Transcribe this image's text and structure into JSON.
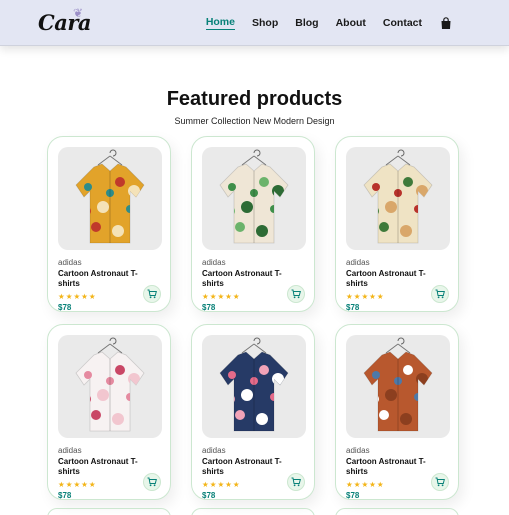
{
  "header": {
    "logo": "Cara",
    "nav": [
      {
        "label": "Home",
        "active": true
      },
      {
        "label": "Shop",
        "active": false
      },
      {
        "label": "Blog",
        "active": false
      },
      {
        "label": "About",
        "active": false
      },
      {
        "label": "Contact",
        "active": false
      }
    ],
    "cart_icon": "shopping-bag-icon"
  },
  "section": {
    "title": "Featured products",
    "subtitle": "Summer Collection New Modern Design"
  },
  "products": [
    {
      "brand": "adidas",
      "name": "Cartoon Astronaut T-shirts",
      "stars": "★★★★★",
      "rating": 5,
      "price": "$78",
      "image": "yellow-teal-patterned-shirt"
    },
    {
      "brand": "adidas",
      "name": "Cartoon Astronaut T-shirts",
      "stars": "★★★★★",
      "rating": 5,
      "price": "$78",
      "image": "green-tropical-leaf-shirt"
    },
    {
      "brand": "adidas",
      "name": "Cartoon Astronaut T-shirts",
      "stars": "★★★★★",
      "rating": 5,
      "price": "$78",
      "image": "red-floral-shirt"
    },
    {
      "brand": "adidas",
      "name": "Cartoon Astronaut T-shirts",
      "stars": "★★★★★",
      "rating": 5,
      "price": "$78",
      "image": "white-pink-blossom-shirt"
    },
    {
      "brand": "adidas",
      "name": "Cartoon Astronaut T-shirts",
      "stars": "★★★★★",
      "rating": 5,
      "price": "$78",
      "image": "navy-pink-floral-shirt"
    },
    {
      "brand": "adidas",
      "name": "Cartoon Astronaut T-shirts",
      "stars": "★★★★★",
      "rating": 5,
      "price": "$78",
      "image": "rust-denim-shirt"
    }
  ],
  "colors": {
    "accent": "#088178",
    "header_bg": "#e3e6f3",
    "star": "#f3b519",
    "card_border": "#cce7d0"
  }
}
